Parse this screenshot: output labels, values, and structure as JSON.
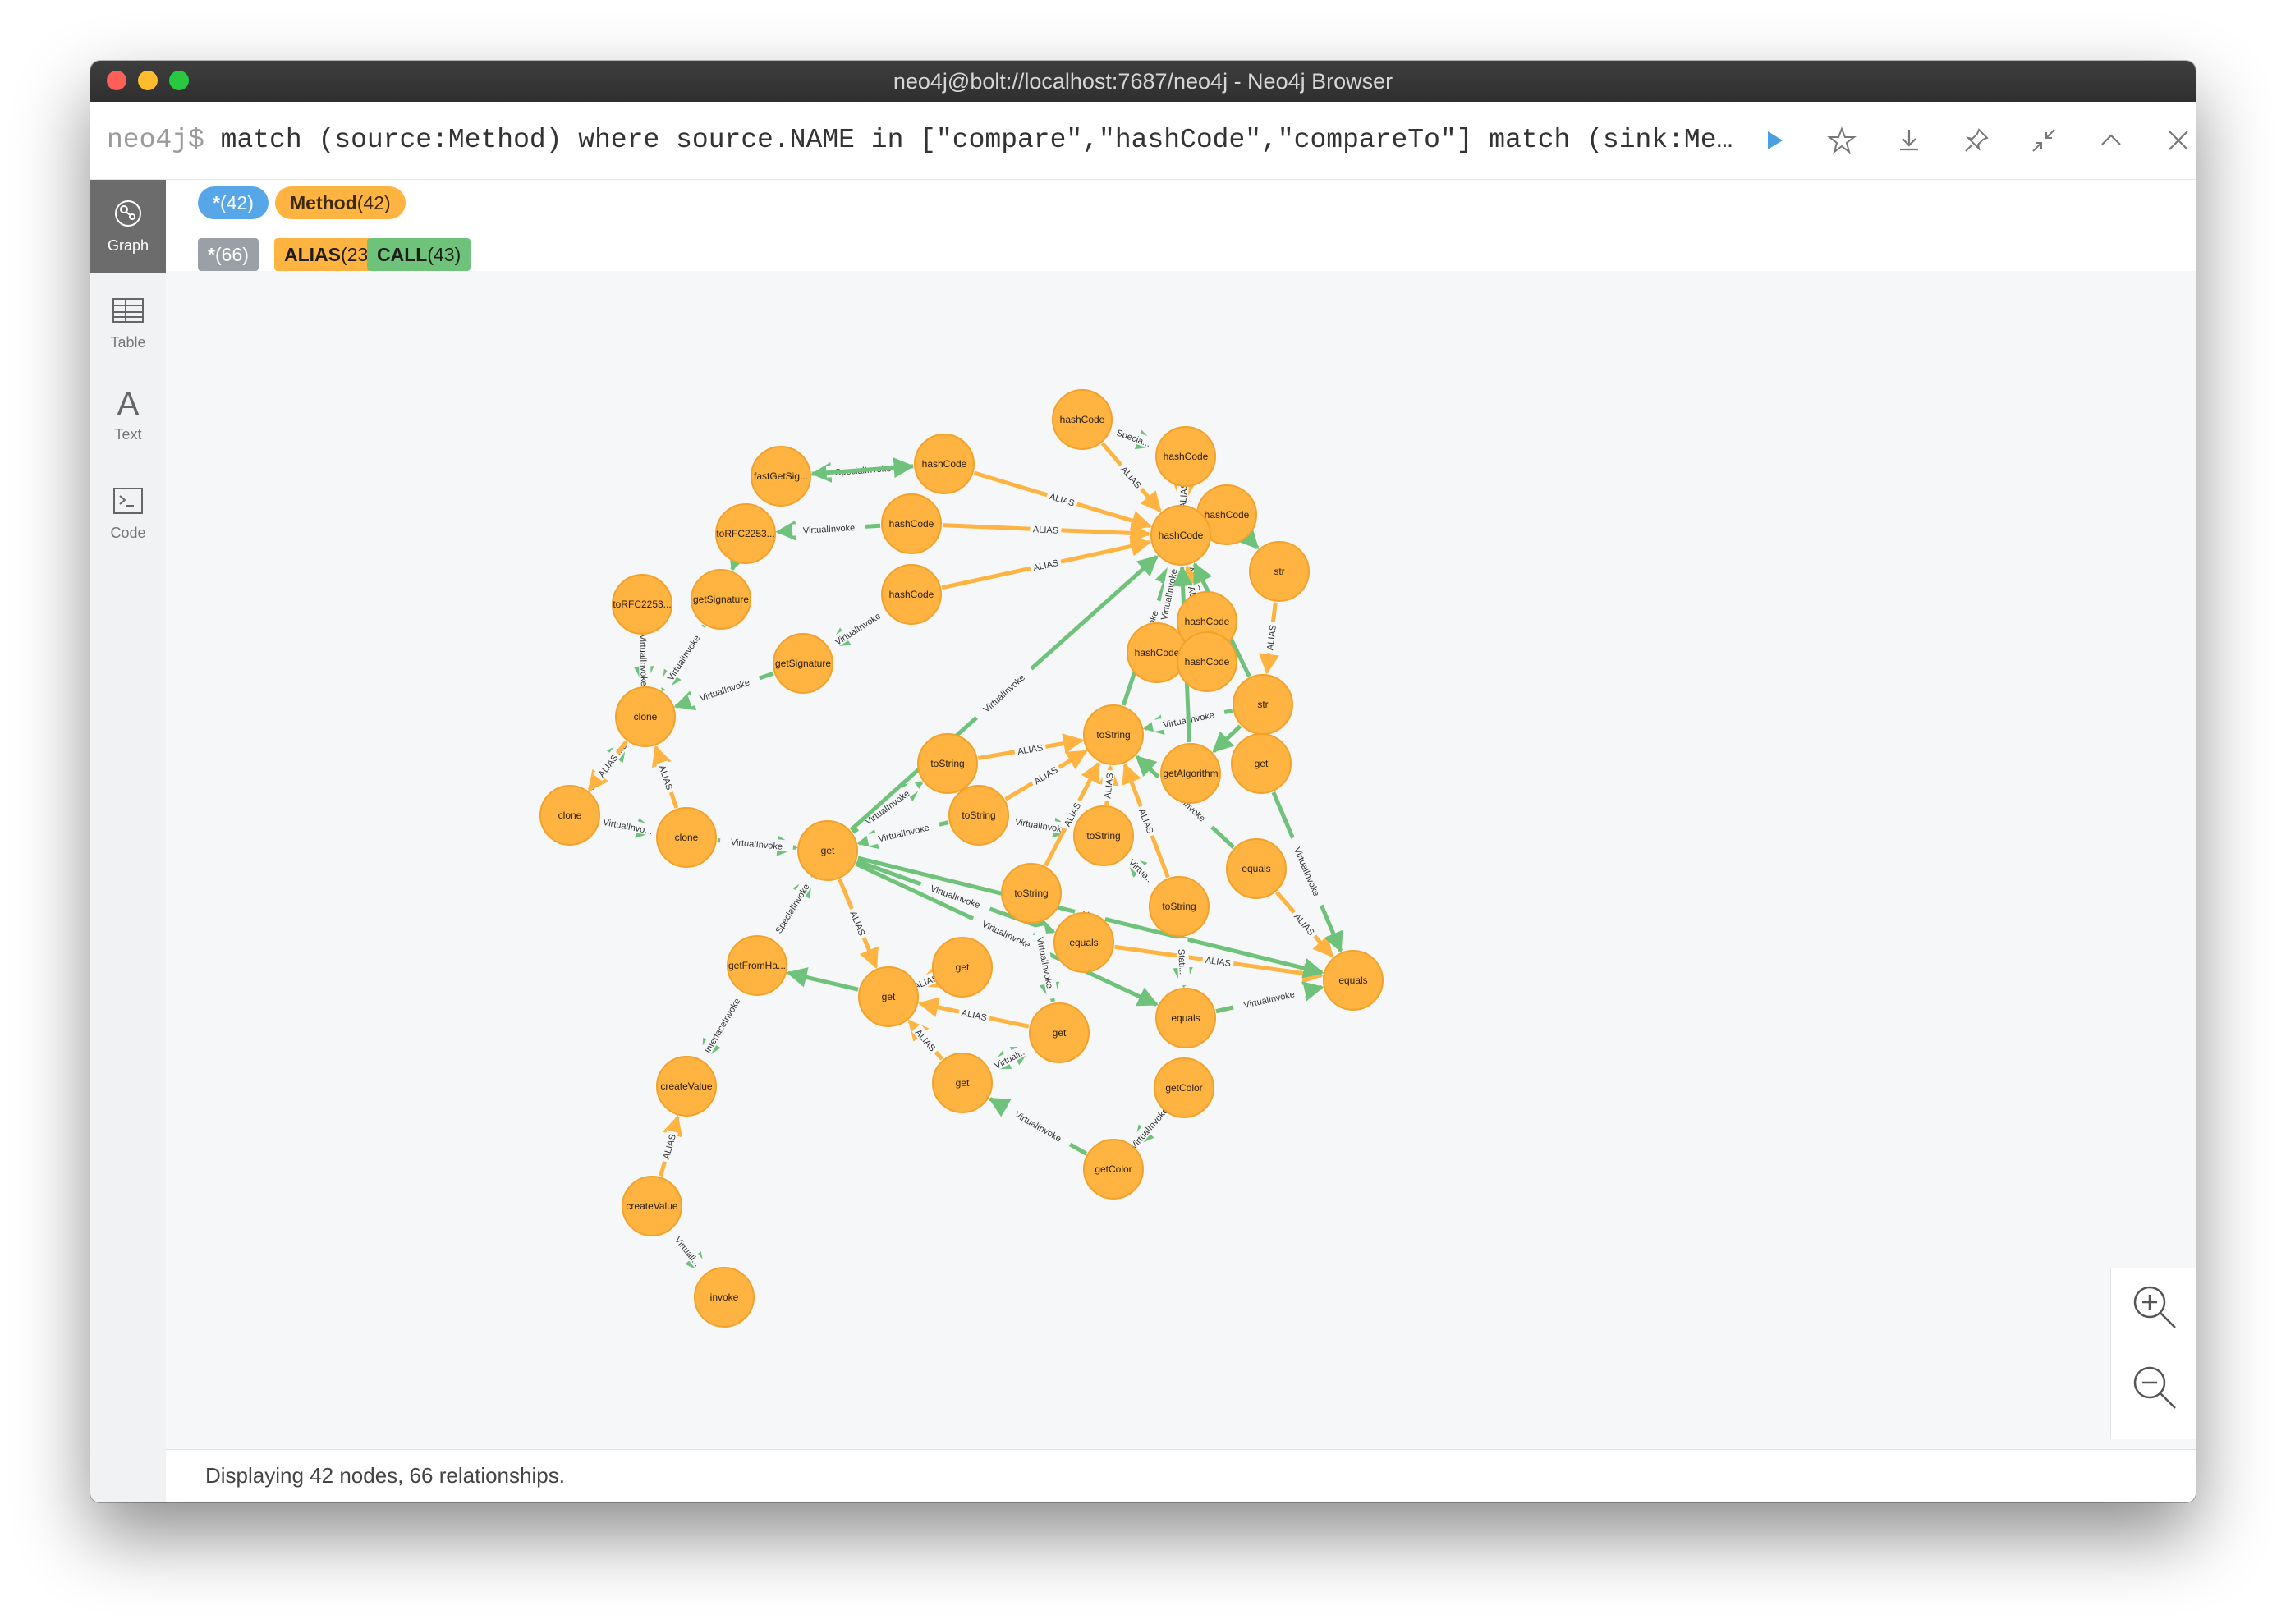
{
  "window": {
    "title": "neo4j@bolt://localhost:7687/neo4j - Neo4j Browser"
  },
  "editor": {
    "prompt": "neo4j$",
    "query": "match (source:Method) where source.NAME in [\"compare\",\"hashCode\",\"compareTo\"] match (sink:Method…",
    "toolbar": [
      "run-icon",
      "star-icon",
      "download-icon",
      "pin-icon",
      "collapse-icon",
      "chevron-up-icon",
      "close-icon"
    ]
  },
  "sidebar": [
    {
      "label": "Graph",
      "icon": "graph-icon",
      "active": true
    },
    {
      "label": "Table",
      "icon": "table-icon",
      "active": false
    },
    {
      "label": "Text",
      "icon": "text-icon",
      "active": false
    },
    {
      "label": "Code",
      "icon": "code-icon",
      "active": false
    }
  ],
  "legend": {
    "node_labels": [
      {
        "name": "*",
        "count": "(42)",
        "color": "#57a7e8"
      },
      {
        "name": "Method",
        "count": "(42)",
        "color": "#ffb340"
      }
    ],
    "rel_types": [
      {
        "name": "*",
        "count": "(66)",
        "color": "#9aa0a6"
      },
      {
        "name": "ALIAS",
        "count": "(23)",
        "color": "#ffb340"
      },
      {
        "name": "CALL",
        "count": "(43)",
        "color": "#6fc27a"
      }
    ]
  },
  "colors": {
    "node_fill": "#ffb340",
    "node_stroke": "#f2a22a",
    "alias": "#ffb340",
    "call": "#6fc27a"
  },
  "status": "Displaying 42 nodes, 66 relationships.",
  "graph": {
    "nodes": [
      {
        "id": "n1",
        "label": "hashCode"
      },
      {
        "id": "n2",
        "label": "hashCode"
      },
      {
        "id": "n3",
        "label": "hashCode"
      },
      {
        "id": "n4",
        "label": "hashCode"
      },
      {
        "id": "n5",
        "label": "hashCode"
      },
      {
        "id": "n6",
        "label": "fastGetSig..."
      },
      {
        "id": "n7",
        "label": "hashCode"
      },
      {
        "id": "n8",
        "label": "toRFC2253..."
      },
      {
        "id": "n9",
        "label": "hashCode"
      },
      {
        "id": "n10",
        "label": "str"
      },
      {
        "id": "n11",
        "label": "toRFC2253..."
      },
      {
        "id": "n12",
        "label": "getSignature"
      },
      {
        "id": "n13",
        "label": "hashCode"
      },
      {
        "id": "n14",
        "label": "hashCode"
      },
      {
        "id": "n15",
        "label": "hashCode"
      },
      {
        "id": "n16",
        "label": "getSignature"
      },
      {
        "id": "n17",
        "label": "str"
      },
      {
        "id": "n18",
        "label": "clone"
      },
      {
        "id": "n19",
        "label": "toString"
      },
      {
        "id": "n20",
        "label": "toString"
      },
      {
        "id": "n21",
        "label": "getAlgorithm"
      },
      {
        "id": "n22",
        "label": "get"
      },
      {
        "id": "n23",
        "label": "clone"
      },
      {
        "id": "n24",
        "label": "clone"
      },
      {
        "id": "n25",
        "label": "toString"
      },
      {
        "id": "n26",
        "label": "toString"
      },
      {
        "id": "n27",
        "label": "get"
      },
      {
        "id": "n28",
        "label": "equals"
      },
      {
        "id": "n29",
        "label": "toString"
      },
      {
        "id": "n30",
        "label": "toString"
      },
      {
        "id": "n31",
        "label": "equals"
      },
      {
        "id": "n32",
        "label": "getFromHa..."
      },
      {
        "id": "n33",
        "label": "get"
      },
      {
        "id": "n34",
        "label": "get"
      },
      {
        "id": "n35",
        "label": "equals"
      },
      {
        "id": "n36",
        "label": "equals"
      },
      {
        "id": "n37",
        "label": "get"
      },
      {
        "id": "n38",
        "label": "get"
      },
      {
        "id": "n39",
        "label": "createValue"
      },
      {
        "id": "n40",
        "label": "getColor"
      },
      {
        "id": "n41",
        "label": "getColor"
      },
      {
        "id": "n42",
        "label": "createValue"
      },
      {
        "id": "n43",
        "label": "invoke"
      }
    ],
    "edges": [
      {
        "s": "n1",
        "t": "n7",
        "type": "ALIAS",
        "label": "ALIAS"
      },
      {
        "s": "n1",
        "t": "n2",
        "type": "CALL",
        "label": "Specia..."
      },
      {
        "s": "n2",
        "t": "n7",
        "type": "ALIAS",
        "label": "ALIAS"
      },
      {
        "s": "n3",
        "t": "n7",
        "type": "CALL",
        "label": "SpecialInvoke"
      },
      {
        "s": "n3",
        "t": "n10",
        "type": "CALL",
        "label": ""
      },
      {
        "s": "n4",
        "t": "n6",
        "type": "CALL",
        "label": "SpecialInvoke"
      },
      {
        "s": "n4",
        "t": "n7",
        "type": "ALIAS",
        "label": "ALIAS"
      },
      {
        "s": "n5",
        "t": "n8",
        "type": "CALL",
        "label": "VirtualInvoke"
      },
      {
        "s": "n5",
        "t": "n7",
        "type": "ALIAS",
        "label": "ALIAS"
      },
      {
        "s": "n9",
        "t": "n7",
        "type": "ALIAS",
        "label": "ALIAS"
      },
      {
        "s": "n9",
        "t": "n16",
        "type": "CALL",
        "label": "VirtualInvoke"
      },
      {
        "s": "n3",
        "t": "n7",
        "type": "ALIAS",
        "label": "ALIAS"
      },
      {
        "s": "n8",
        "t": "n12",
        "type": "CALL",
        "label": ""
      },
      {
        "s": "n11",
        "t": "n18",
        "type": "CALL",
        "label": "VirtualInvoke"
      },
      {
        "s": "n12",
        "t": "n18",
        "type": "CALL",
        "label": "VirtualInvoke"
      },
      {
        "s": "n16",
        "t": "n18",
        "type": "CALL",
        "label": "VirtualInvoke"
      },
      {
        "s": "n10",
        "t": "n17",
        "type": "ALIAS",
        "label": "ALIAS"
      },
      {
        "s": "n13",
        "t": "n7",
        "type": "ALIAS",
        "label": "ALIAS"
      },
      {
        "s": "n14",
        "t": "n7",
        "type": "ALIAS",
        "label": "ALIAS"
      },
      {
        "s": "n15",
        "t": "n7",
        "type": "ALIAS",
        "label": "ALIAS"
      },
      {
        "s": "n17",
        "t": "n19",
        "type": "CALL",
        "label": "VirtualInvoke"
      },
      {
        "s": "n17",
        "t": "n7",
        "type": "CALL",
        "label": ""
      },
      {
        "s": "n17",
        "t": "n21",
        "type": "CALL",
        "label": ""
      },
      {
        "s": "n19",
        "t": "n7",
        "type": "CALL",
        "label": "VirtualInvoke"
      },
      {
        "s": "n20",
        "t": "n19",
        "type": "ALIAS",
        "label": "ALIAS"
      },
      {
        "s": "n23",
        "t": "n18",
        "type": "CALL",
        "label": "SpecialInvoke"
      },
      {
        "s": "n23",
        "t": "n24",
        "type": "CALL",
        "label": "VirtualInvo..."
      },
      {
        "s": "n24",
        "t": "n18",
        "type": "ALIAS",
        "label": "ALIAS"
      },
      {
        "s": "n18",
        "t": "n23",
        "type": "ALIAS",
        "label": "ALIAS"
      },
      {
        "s": "n24",
        "t": "n27",
        "type": "CALL",
        "label": "VirtualInvoke"
      },
      {
        "s": "n27",
        "t": "n20",
        "type": "CALL",
        "label": "VirtualInvoke"
      },
      {
        "s": "n27",
        "t": "n7",
        "type": "CALL",
        "label": "VirtualInvoke"
      },
      {
        "s": "n25",
        "t": "n19",
        "type": "ALIAS",
        "label": "ALIAS"
      },
      {
        "s": "n25",
        "t": "n27",
        "type": "CALL",
        "label": "VirtualInvoke"
      },
      {
        "s": "n25",
        "t": "n26",
        "type": "CALL",
        "label": "VirtualInvoke"
      },
      {
        "s": "n26",
        "t": "n19",
        "type": "ALIAS",
        "label": "ALIAS"
      },
      {
        "s": "n29",
        "t": "n19",
        "type": "ALIAS",
        "label": "ALIAS"
      },
      {
        "s": "n30",
        "t": "n19",
        "type": "ALIAS",
        "label": "ALIAS"
      },
      {
        "s": "n30",
        "t": "n26",
        "type": "CALL",
        "label": "Virtua..."
      },
      {
        "s": "n28",
        "t": "n19",
        "type": "CALL",
        "label": "VirtualInvoke"
      },
      {
        "s": "n28",
        "t": "n36",
        "type": "ALIAS",
        "label": "ALIAS"
      },
      {
        "s": "n22",
        "t": "n36",
        "type": "CALL",
        "label": "VirtualInvoke"
      },
      {
        "s": "n31",
        "t": "n36",
        "type": "ALIAS",
        "label": "ALIAS"
      },
      {
        "s": "n27",
        "t": "n31",
        "type": "CALL",
        "label": "VirtualInvoke"
      },
      {
        "s": "n27",
        "t": "n36",
        "type": "CALL",
        "label": "Vi..."
      },
      {
        "s": "n32",
        "t": "n27",
        "type": "CALL",
        "label": "SpecialInvoke"
      },
      {
        "s": "n27",
        "t": "n33",
        "type": "ALIAS",
        "label": "ALIAS"
      },
      {
        "s": "n27",
        "t": "n35",
        "type": "CALL",
        "label": "VirtualInvoke"
      },
      {
        "s": "n35",
        "t": "n36",
        "type": "ALIAS",
        "label": "ALIAS"
      },
      {
        "s": "n35",
        "t": "n36",
        "type": "CALL",
        "label": "VirtualInvoke"
      },
      {
        "s": "n29",
        "t": "n37",
        "type": "CALL",
        "label": "VirtualInvoke"
      },
      {
        "s": "n34",
        "t": "n33",
        "type": "ALIAS",
        "label": "ALIAS"
      },
      {
        "s": "n37",
        "t": "n33",
        "type": "ALIAS",
        "label": "ALIAS"
      },
      {
        "s": "n37",
        "t": "n38",
        "type": "CALL",
        "label": "Special..."
      },
      {
        "s": "n38",
        "t": "n33",
        "type": "ALIAS",
        "label": "ALIAS"
      },
      {
        "s": "n38",
        "t": "n37",
        "type": "CALL",
        "label": "Virtuali..."
      },
      {
        "s": "n33",
        "t": "n32",
        "type": "CALL",
        "label": ""
      },
      {
        "s": "n32",
        "t": "n39",
        "type": "CALL",
        "label": "InterfaceInvoke"
      },
      {
        "s": "n42",
        "t": "n39",
        "type": "ALIAS",
        "label": "ALIAS"
      },
      {
        "s": "n42",
        "t": "n43",
        "type": "CALL",
        "label": "Virtuali..."
      },
      {
        "s": "n41",
        "t": "n38",
        "type": "CALL",
        "label": "VirtualInvoke"
      },
      {
        "s": "n40",
        "t": "n41",
        "type": "CALL",
        "label": "VirtualInvoke"
      },
      {
        "s": "n30",
        "t": "n35",
        "type": "CALL",
        "label": "Stati..."
      },
      {
        "s": "n14",
        "t": "n7",
        "type": "CALL",
        "label": "VirtualInvoke"
      },
      {
        "s": "n21",
        "t": "n7",
        "type": "CALL",
        "label": ""
      },
      {
        "s": "n6",
        "t": "n4",
        "type": "CALL",
        "label": ""
      }
    ]
  }
}
